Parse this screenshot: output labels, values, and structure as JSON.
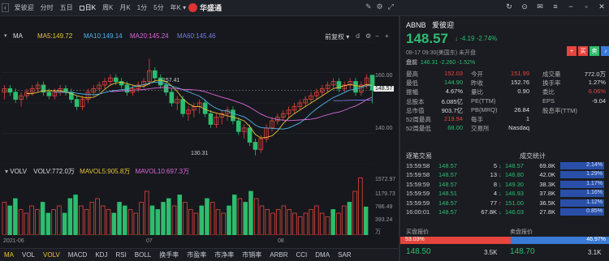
{
  "toolbar": {
    "title": "爱彼迎",
    "periods": [
      "分时",
      "五日",
      "日K",
      "周K",
      "月K",
      "1分",
      "5分",
      "年K ▾"
    ],
    "active_period_index": 2
  },
  "app": {
    "logo_text": "华盛通"
  },
  "ma": {
    "label": "MA",
    "items": [
      {
        "text": "MA5:149.72",
        "color": "#e7c33a"
      },
      {
        "text": "MA10:149.14",
        "color": "#4fb3ea"
      },
      {
        "text": "MA20:145.24",
        "color": "#d967d9"
      },
      {
        "text": "MA60:145.46",
        "color": "#7b7bea"
      }
    ],
    "adjust_label": "前复权"
  },
  "stock": {
    "code": "ABNB",
    "name": "爱彼迎",
    "price": "148.57",
    "change": "↓ -4.19  -2.74%",
    "meta": "08-17  09:30(美国东)   未开盘",
    "after_label": "盘前",
    "after_value": "146.31  -2.260  -1.52%"
  },
  "stats": [
    {
      "l1": "最高",
      "v1": "152.03",
      "c1": "#e5453d",
      "l2": "今开",
      "v2": "151.99",
      "c2": "#e5453d",
      "l3": "成交量",
      "v3": "772.0万",
      "c3": "#ddd"
    },
    {
      "l1": "最低",
      "v1": "144.90",
      "c1": "#2dbd6e",
      "l2": "昨收",
      "v2": "152.76",
      "c2": "#ddd",
      "l3": "换手率",
      "v3": "1.27%",
      "c3": "#ddd"
    },
    {
      "l1": "振幅",
      "v1": "4.67%",
      "c1": "#ddd",
      "l2": "量比",
      "v2": "0.90",
      "c2": "#ddd",
      "l3": "委比",
      "v3": "6.06%",
      "c3": "#e5453d"
    },
    {
      "l1": "总股本",
      "v1": "6.085亿",
      "c1": "#ddd",
      "l2": "PE(TTM)",
      "v2": "",
      "c2": "#ddd",
      "l3": "EPS",
      "v3": "-9.04",
      "c3": "#ddd"
    },
    {
      "l1": "总市值",
      "v1": "903.7亿",
      "c1": "#ddd",
      "l2": "PB(MRQ)",
      "v2": "26.84",
      "c2": "#ddd",
      "l3": "股息率(TTM)",
      "v3": "",
      "c3": "#ddd"
    },
    {
      "l1": "52周最高",
      "v1": "219.94",
      "c1": "#e5453d",
      "l2": "每手",
      "v2": "1",
      "c2": "#ddd",
      "l3": "",
      "v3": "",
      "c3": "#ddd"
    },
    {
      "l1": "52周最低",
      "v1": "68.00",
      "c1": "#2dbd6e",
      "l2": "交易所",
      "v2": "Nasdaq",
      "c2": "#ddd",
      "l3": "",
      "v3": "",
      "c3": "#ddd"
    }
  ],
  "trades_header": {
    "left": "逐笔交易",
    "right": "成交统计"
  },
  "trades": [
    {
      "time": "15:59:58",
      "price": "148.57",
      "vol": "5",
      "dir": "↓",
      "dc": "#2dbd6e",
      "p2": "148.57",
      "q2": "69.8K",
      "pct": "2.14%"
    },
    {
      "time": "15:59:58",
      "price": "148.57",
      "vol": "13",
      "dir": "↓",
      "dc": "#2dbd6e",
      "p2": "146.80",
      "q2": "42.0K",
      "pct": "1.29%"
    },
    {
      "time": "15:59:59",
      "price": "148.57",
      "vol": "8",
      "dir": "↓",
      "dc": "#2dbd6e",
      "p2": "149.30",
      "q2": "38.3K",
      "pct": "1.17%"
    },
    {
      "time": "15:59:59",
      "price": "148.51",
      "vol": "4",
      "dir": "↓",
      "dc": "#2dbd6e",
      "p2": "146.93",
      "q2": "37.8K",
      "pct": "1.16%"
    },
    {
      "time": "15:59:59",
      "price": "148.57",
      "vol": "77",
      "dir": "↑",
      "dc": "#e5453d",
      "p2": "151.00",
      "q2": "36.5K",
      "pct": "1.12%"
    },
    {
      "time": "16:00:01",
      "price": "148.57",
      "vol": "67.8K",
      "dir": "↓",
      "dc": "#2dbd6e",
      "p2": "146.03",
      "q2": "27.8K",
      "pct": "0.85%"
    }
  ],
  "orderbook": {
    "bid_label": "买盘报价",
    "ask_label": "卖盘报价",
    "bid_pct": "53.03%",
    "ask_pct": "46.97%",
    "bid_fraction": 0.5303,
    "bid_price": "148.50",
    "bid_vol": "3.5K",
    "ask_price": "148.70",
    "ask_vol": "3.1K"
  },
  "kline_axis": {
    "high": "160.00",
    "low": "140.00",
    "current": "148.57",
    "mark_high": "157.41",
    "mark_low": "130.31"
  },
  "volume": {
    "label": "VOLV",
    "vol": "VOLV:772.0万",
    "mavol5": "MAVOL5:905.8万",
    "mavol10": "MAVOL10:697.3万",
    "axis": [
      "1572.97",
      "1179.73",
      "786.49",
      "393.24",
      "万"
    ]
  },
  "dates": [
    "2021-06",
    "07",
    "08"
  ],
  "bottom_tabs": [
    "MA",
    "VOL",
    "VOLV",
    "MACD",
    "KDJ",
    "RSI",
    "BOLL",
    "换手率",
    "市盈率",
    "市净率",
    "市销率",
    "ARBR",
    "CCI",
    "DMA",
    "SAR"
  ],
  "active_tabs": [
    0,
    2
  ],
  "colors": {
    "up": "#e5453d",
    "down": "#2dbd6e",
    "accent": "#f0c23a"
  },
  "chart_data": {
    "type": "candlestick",
    "candles": [
      [
        148,
        150,
        146,
        149
      ],
      [
        149,
        150,
        147,
        148
      ],
      [
        148,
        149,
        145,
        146
      ],
      [
        146,
        148,
        144,
        147
      ],
      [
        147,
        149,
        146,
        148
      ],
      [
        148,
        150,
        147,
        149
      ],
      [
        149,
        151,
        148,
        150
      ],
      [
        150,
        151,
        147,
        148
      ],
      [
        148,
        149,
        146,
        147
      ],
      [
        147,
        149,
        146,
        148
      ],
      [
        148,
        150,
        147,
        149
      ],
      [
        149,
        150,
        147,
        148
      ],
      [
        148,
        149,
        145,
        146
      ],
      [
        146,
        147,
        143,
        144
      ],
      [
        144,
        147,
        143,
        146
      ],
      [
        146,
        149,
        145,
        148
      ],
      [
        148,
        150,
        147,
        149
      ],
      [
        149,
        151,
        148,
        150
      ],
      [
        150,
        152,
        149,
        151
      ],
      [
        151,
        153,
        150,
        152
      ],
      [
        152,
        153,
        150,
        151
      ],
      [
        151,
        152,
        149,
        150
      ],
      [
        150,
        151,
        147,
        148
      ],
      [
        148,
        150,
        147,
        149
      ],
      [
        149,
        151,
        148,
        150
      ],
      [
        150,
        152,
        149,
        151
      ],
      [
        151,
        157.41,
        150,
        154
      ],
      [
        154,
        155,
        151,
        152
      ],
      [
        152,
        153,
        149,
        150
      ],
      [
        150,
        151,
        147,
        148
      ],
      [
        148,
        149,
        144,
        145
      ],
      [
        145,
        147,
        143,
        146
      ],
      [
        146,
        147,
        141,
        142
      ],
      [
        142,
        144,
        140,
        143
      ],
      [
        143,
        145,
        141,
        144
      ],
      [
        144,
        146,
        142,
        145
      ],
      [
        145,
        146,
        141,
        142
      ],
      [
        142,
        143,
        138,
        139
      ],
      [
        139,
        142,
        138,
        141
      ],
      [
        141,
        143,
        139,
        142
      ],
      [
        142,
        144,
        140,
        143
      ],
      [
        143,
        144,
        139,
        140
      ],
      [
        140,
        141,
        136,
        137
      ],
      [
        137,
        139,
        135,
        138
      ],
      [
        138,
        139,
        133,
        134
      ],
      [
        134,
        135,
        130.31,
        132
      ],
      [
        132,
        136,
        131,
        135
      ],
      [
        135,
        139,
        134,
        138
      ],
      [
        138,
        141,
        137,
        140
      ],
      [
        140,
        142,
        139,
        141
      ],
      [
        141,
        143,
        140,
        142
      ],
      [
        142,
        144,
        141,
        143
      ],
      [
        143,
        145,
        142,
        144
      ],
      [
        144,
        146,
        143,
        145
      ],
      [
        145,
        147,
        144,
        146
      ],
      [
        146,
        148,
        145,
        147
      ],
      [
        147,
        149,
        146,
        148
      ],
      [
        148,
        150,
        147,
        149
      ],
      [
        149,
        151,
        148,
        150
      ],
      [
        150,
        152,
        149,
        151
      ],
      [
        151,
        152,
        148,
        149
      ],
      [
        149,
        151,
        148,
        150
      ],
      [
        150,
        152,
        149,
        151
      ],
      [
        151,
        152,
        147,
        148
      ],
      [
        148,
        151,
        147,
        150
      ],
      [
        150,
        153,
        149,
        152
      ],
      [
        152.76,
        152.03,
        144.9,
        148.57
      ]
    ],
    "volumes": [
      9,
      8,
      10,
      7,
      6,
      8,
      7,
      9,
      6,
      7,
      8,
      6,
      10,
      11,
      8,
      7,
      9,
      10,
      8,
      7,
      6,
      9,
      8,
      7,
      6,
      9,
      12,
      8,
      7,
      9,
      10,
      8,
      11,
      9,
      7,
      6,
      8,
      10,
      9,
      7,
      6,
      8,
      11,
      10,
      9,
      12,
      10,
      8,
      7,
      6,
      7,
      8,
      7,
      6,
      5,
      6,
      7,
      8,
      6,
      5,
      7,
      6,
      8,
      9,
      12,
      15.7,
      7.7
    ],
    "ylim": [
      128,
      162
    ]
  }
}
